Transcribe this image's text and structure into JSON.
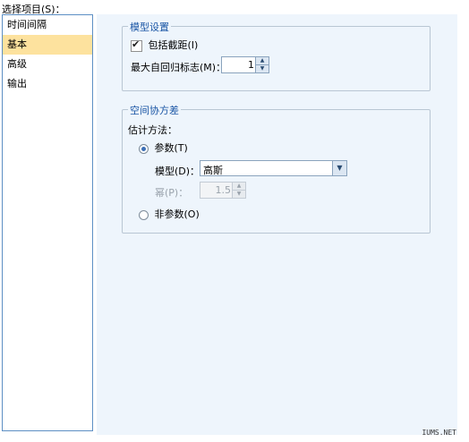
{
  "select_items_label": "选择项目(S)：",
  "sidebar": {
    "items": [
      {
        "label": "时间间隔",
        "selected": false
      },
      {
        "label": "基本",
        "selected": true
      },
      {
        "label": "高级",
        "selected": false
      },
      {
        "label": "输出",
        "selected": false
      }
    ]
  },
  "model_settings": {
    "title": "模型设置",
    "include_intercept_label": "包括截距(I)",
    "include_intercept_checked": true,
    "max_autoregressive_label": "最大自回归标志(M)：",
    "max_autoregressive_value": "1"
  },
  "spatial_covariance": {
    "title": "空间协方差",
    "estimation_label": "估计方法：",
    "parametric_label": "参数(T)",
    "parametric_selected": true,
    "model_label": "模型(D)：",
    "model_value": "高斯",
    "power_label": "幂(P)：",
    "power_value": "1.5",
    "power_enabled": false,
    "nonparametric_label": "非参数(O)",
    "nonparametric_selected": false
  },
  "watermark": "IUMS.NET"
}
